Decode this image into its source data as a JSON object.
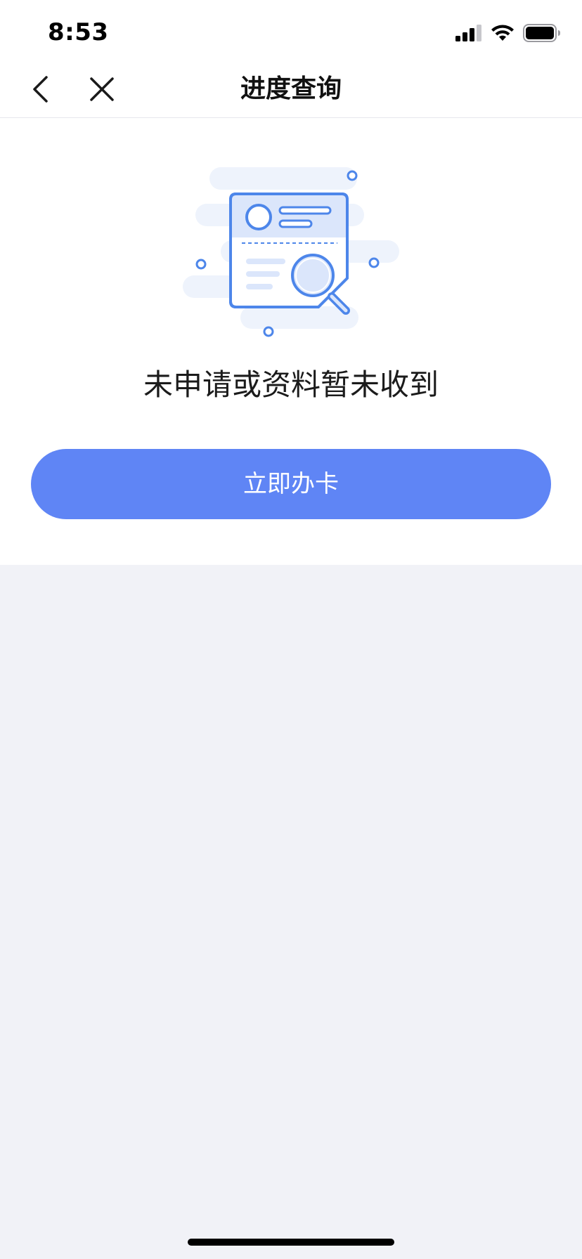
{
  "status_bar": {
    "time": "8:53",
    "icons": [
      "cellular-signal-icon",
      "wifi-icon",
      "battery-icon"
    ]
  },
  "nav": {
    "title": "进度查询",
    "back_icon": "chevron-left-icon",
    "close_icon": "close-icon"
  },
  "empty_state": {
    "illustration": "document-search-illustration",
    "message": "未申请或资料暂未收到"
  },
  "actions": {
    "apply_label": "立即办卡"
  },
  "colors": {
    "primary": "#5f85f5",
    "page_background": "#f1f2f7",
    "illustration_stroke": "#4d86ea",
    "illustration_fill": "#dbe6fb"
  }
}
